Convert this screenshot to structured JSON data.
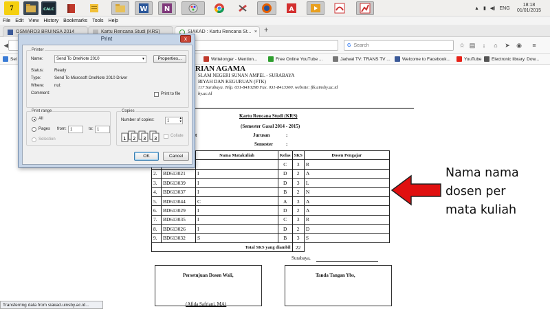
{
  "taskbar": {
    "start_label": "7",
    "calculator_label": "CALC",
    "language": "ENG",
    "time": "18:18",
    "date": "01/01/2015"
  },
  "browser": {
    "menu": [
      "File",
      "Edit",
      "View",
      "History",
      "Bookmarks",
      "Tools",
      "Help"
    ],
    "tabs": [
      {
        "label": "OSMARO3 BRUINSA 2014"
      },
      {
        "label": "Kartu Rencana Studi (KRS)"
      },
      {
        "label": "SIAKAD : Kartu Rencana St..."
      }
    ],
    "new_tab_label": "+",
    "search_placeholder": "Search",
    "bookmarks": [
      {
        "label": "Sel",
        "color": "#3a7bd5"
      },
      {
        "label": "Writelonger - Mention...",
        "color": "#c0392b"
      },
      {
        "label": "Free Online YouTube ...",
        "color": "#2e9e2e"
      },
      {
        "label": "Jadwal TV: TRANS TV ...",
        "color": "#777777"
      },
      {
        "label": "Welcome to Facebook...",
        "color": "#3b5998"
      },
      {
        "label": "YouTube",
        "color": "#e62117"
      },
      {
        "label": "Electronic library. Dow...",
        "color": "#555555"
      }
    ],
    "status_text": "Transferring data from siakad.uinsby.ac.id..."
  },
  "document": {
    "header_title": "RIAN AGAMA",
    "header_line1": "SLAM NEGERI SUNAN AMPEL - SURABAYA",
    "header_line2": "BIYAH DAN KEGURUAN (FTK)",
    "header_line3": "117 Surabaya. Telp. 031-8410298 Fax. 031-8413300. website: ftk.uinsby.ac.id",
    "header_line4": "by.ac.id",
    "krs_title": "Kartu Rencana Studi (KRS)",
    "semester_title": "(Semester Gasal 2014 - 2015)",
    "field_t": "t",
    "jurusan_label": "Jurusan",
    "jurusan_value": ":",
    "semester_label": "Semester",
    "semester_value": ":",
    "table_headers": {
      "matakuliah": "Nama Matakuliah",
      "kelas": "Kelas",
      "sks": "SKS",
      "dosen": "Dosen Pengajar"
    },
    "rows": [
      {
        "no": "",
        "kode": "",
        "nama": "",
        "kelas": "C",
        "sks": "3",
        "dosen": "R"
      },
      {
        "no": "2.",
        "kode": "BD613021",
        "nama": "I",
        "kelas": "D",
        "sks": "2",
        "dosen": "A"
      },
      {
        "no": "3.",
        "kode": "BD613039",
        "nama": "I",
        "kelas": "D",
        "sks": "3",
        "dosen": "L"
      },
      {
        "no": "4.",
        "kode": "BD613037",
        "nama": "I",
        "kelas": "B",
        "sks": "2",
        "dosen": "N"
      },
      {
        "no": "5.",
        "kode": "BD613044",
        "nama": "C",
        "kelas": "A",
        "sks": "3",
        "dosen": "A"
      },
      {
        "no": "6.",
        "kode": "BD613029",
        "nama": "I",
        "kelas": "D",
        "sks": "2",
        "dosen": "A"
      },
      {
        "no": "7.",
        "kode": "BD613035",
        "nama": "I",
        "kelas": "C",
        "sks": "3",
        "dosen": "R"
      },
      {
        "no": "8.",
        "kode": "BD613026",
        "nama": "I",
        "kelas": "D",
        "sks": "2",
        "dosen": "D"
      },
      {
        "no": "9.",
        "kode": "BD613032",
        "nama": "S",
        "kelas": "B",
        "sks": "3",
        "dosen": "S"
      }
    ],
    "total_label": "Total SKS yang diambil",
    "total_value": "22",
    "city_label": "Surabaya,",
    "approval_label": "Persetujuan Dosen Wali,",
    "signature_label": "Tanda Tangan Ybs,",
    "advisor_name": "(Afida Safriani, MA)"
  },
  "annotation": {
    "line1": "Nama nama",
    "line2": "dosen per",
    "line3": "mata kuliah",
    "arrow_color": "#e01010"
  },
  "print_dialog": {
    "title": "Print",
    "close_label": "x",
    "printer_group": "Printer",
    "name_label": "Name:",
    "printer_name": "Send To OneNote 2010",
    "properties_label": "Properties...",
    "status_label": "Status:",
    "status_value": "Ready",
    "type_label": "Type:",
    "type_value": "Send To Microsoft OneNote 2010 Driver",
    "where_label": "Where:",
    "where_value": "nul:",
    "comment_label": "Comment:",
    "print_to_file_label": "Print to file",
    "range_group": "Print range",
    "all_label": "All",
    "pages_label": "Pages",
    "from_label": "from:",
    "from_value": "1",
    "to_label": "to:",
    "to_value": "1",
    "selection_label": "Selection",
    "copies_group": "Copies",
    "copies_label": "Number of copies:",
    "copies_value": "1",
    "collate_label": "Collate",
    "ok_label": "OK",
    "cancel_label": "Cancel"
  }
}
